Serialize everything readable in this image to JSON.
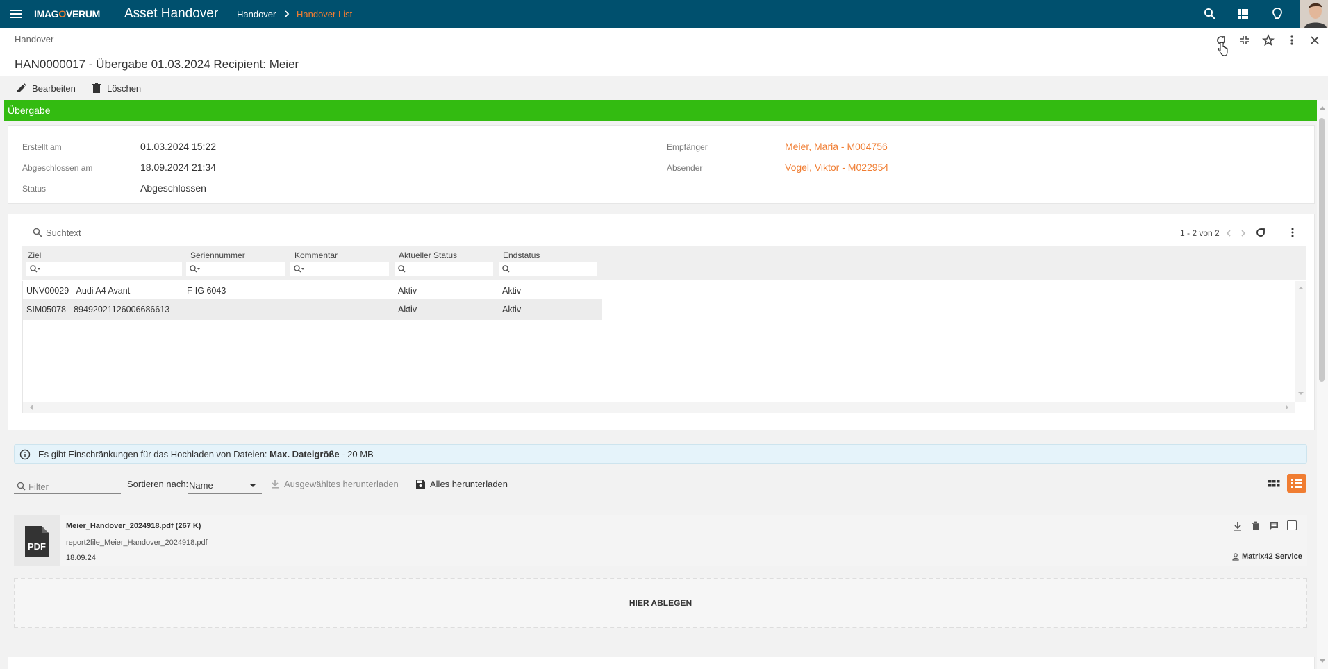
{
  "topbar": {
    "logo": {
      "pre": "IMAG",
      "o": "O",
      "post": "VERUM"
    },
    "app_title": "Asset Handover",
    "breadcrumb": [
      "Handover",
      "Handover List"
    ],
    "icons": [
      "search-icon",
      "apps-grid-icon",
      "lightbulb-icon",
      "avatar"
    ],
    "bg_color": "#00506e",
    "accent_color": "#f07d32"
  },
  "header": {
    "subtitle": "Handover",
    "record_title": "HAN0000017 - Übergabe 01.03.2024 Recipient: Meier",
    "icons": [
      "refresh-icon",
      "collapse-icon",
      "star-icon",
      "more-vert-icon",
      "close-icon"
    ]
  },
  "actions": {
    "edit_label": "Bearbeiten",
    "delete_label": "Löschen"
  },
  "section": {
    "title": "Übergabe",
    "color": "#33bb11"
  },
  "details": {
    "created_label": "Erstellt am",
    "created_value": "01.03.2024 15:22",
    "closed_label": "Abgeschlossen am",
    "closed_value": "18.09.2024 21:34",
    "status_label": "Status",
    "status_value": "Abgeschlossen",
    "recipient_label": "Empfänger",
    "recipient_value": "Meier, Maria - M004756",
    "sender_label": "Absender",
    "sender_value": "Vogel, Viktor - M022954"
  },
  "grid": {
    "search_placeholder": "Suchtext",
    "pager": "1 - 2 von 2",
    "columns": [
      "Ziel",
      "Seriennummer",
      "Kommentar",
      "Aktueller Status",
      "Endstatus"
    ],
    "rows": [
      [
        "UNV00029 - Audi A4 Avant",
        "F-IG 6043",
        "",
        "Aktiv",
        "Aktiv"
      ],
      [
        "SIM05078 - 89492021126006686613",
        "",
        "",
        "Aktiv",
        "Aktiv"
      ]
    ]
  },
  "upload": {
    "info_text": "Es gibt Einschränkungen für das Hochladen von Dateien:",
    "info_bold": "Max. Dateigröße",
    "info_suffix": " - 20 MB",
    "filter_placeholder": "Filter",
    "sort_label": "Sortieren nach:",
    "sort_value": "Name",
    "download_selected": "Ausgewähltes herunterladen",
    "download_all": "Alles herunterladen",
    "file": {
      "name": "Meier_Handover_2024918.pdf (267 K)",
      "source": "report2file_Meier_Handover_2024918.pdf",
      "date": "18.09.24",
      "owner": "Matrix42 Service",
      "type_label": "PDF"
    },
    "drop_label": "HIER ABLEGEN"
  }
}
